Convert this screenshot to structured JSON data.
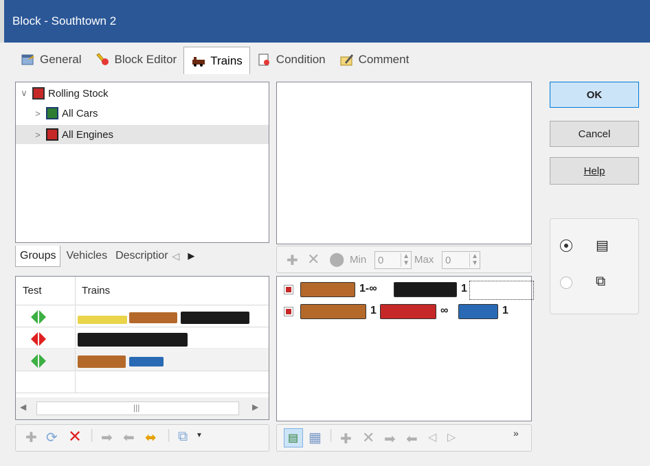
{
  "window": {
    "title": "Block - Southtown 2"
  },
  "tabs": [
    {
      "label": "General",
      "icon": "general-icon"
    },
    {
      "label": "Block Editor",
      "icon": "block-editor-icon"
    },
    {
      "label": "Trains",
      "icon": "trains-icon",
      "active": true
    },
    {
      "label": "Condition",
      "icon": "condition-icon"
    },
    {
      "label": "Comment",
      "icon": "comment-icon"
    }
  ],
  "tree": {
    "root": "Rolling Stock",
    "items": [
      "All Cars",
      "All Engines"
    ]
  },
  "lower_tabs": {
    "groups": "Groups",
    "vehicles": "Vehicles",
    "description": "Descriptior"
  },
  "grid": {
    "headers": {
      "test": "Test",
      "trains": "Trains"
    }
  },
  "train_pattern": {
    "min_label": "Min",
    "min_value": "0",
    "max_label": "Max",
    "max_value": "0",
    "row1": {
      "count1": "1-∞",
      "count2": "1"
    },
    "row2": {
      "count1": "1",
      "count2": "∞",
      "count3": "1"
    }
  },
  "buttons": {
    "ok": "OK",
    "cancel": "Cancel",
    "help": "Help"
  },
  "colors": {
    "title_bar": "#2b5797",
    "accent": "#0078d7",
    "green": "#3cb043",
    "red": "#e02020"
  }
}
